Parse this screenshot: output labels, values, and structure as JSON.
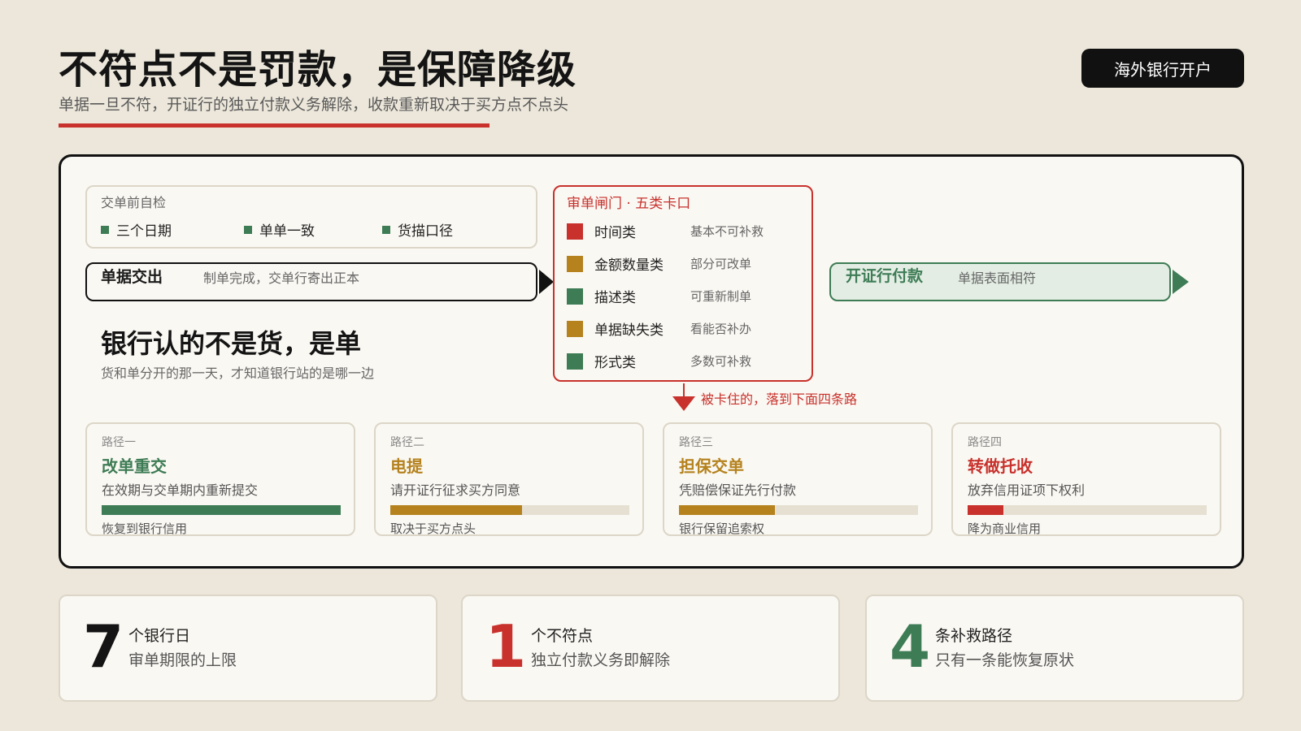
{
  "header": {
    "title": "不符点不是罚款，是保障降级",
    "subtitle": "单据一旦不符，开证行的独立付款义务解除，收款重新取决于买方点不点头",
    "tag": "海外银行开户"
  },
  "precheck": {
    "title": "交单前自检",
    "items": [
      "三个日期",
      "单单一致",
      "货描口径"
    ]
  },
  "submit": {
    "title": "单据交出",
    "desc": "制单完成，交单行寄出正本"
  },
  "headline": {
    "title": "银行认的不是货，是单",
    "sub": "货和单分开的那一天，才知道银行站的是哪一边"
  },
  "gate": {
    "title": "审单闸门 · 五类卡口",
    "rows": [
      {
        "label": "时间类",
        "note": "基本不可补救",
        "color": "#c8312c"
      },
      {
        "label": "金额数量类",
        "note": "部分可改单",
        "color": "#b5821e"
      },
      {
        "label": "描述类",
        "note": "可重新制单",
        "color": "#3e7c55"
      },
      {
        "label": "单据缺失类",
        "note": "看能否补办",
        "color": "#b5821e"
      },
      {
        "label": "形式类",
        "note": "多数可补救",
        "color": "#3e7c55"
      }
    ],
    "down_text": "被卡住的，落到下面四条路"
  },
  "payment": {
    "title": "开证行付款",
    "desc": "单据表面相符"
  },
  "paths": [
    {
      "num": "路径一",
      "name": "改单重交",
      "desc": "在效期与交单期内重新提交",
      "outcome": "恢复到银行信用",
      "level": 1.0,
      "color": "#3e7c55"
    },
    {
      "num": "路径二",
      "name": "电提",
      "desc": "请开证行征求买方同意",
      "outcome": "取决于买方点头",
      "level": 0.55,
      "color": "#b5821e"
    },
    {
      "num": "路径三",
      "name": "担保交单",
      "desc": "凭赔偿保证先行付款",
      "outcome": "银行保留追索权",
      "level": 0.4,
      "color": "#b5821e"
    },
    {
      "num": "路径四",
      "name": "转做托收",
      "desc": "放弃信用证项下权利",
      "outcome": "降为商业信用",
      "level": 0.15,
      "color": "#c8312c"
    }
  ],
  "stats": [
    {
      "num": "7",
      "label": "个银行日",
      "desc": "审单期限的上限",
      "color": "#141414"
    },
    {
      "num": "1",
      "label": "个不符点",
      "desc": "独立付款义务即解除",
      "color": "#c8312c"
    },
    {
      "num": "4",
      "label": "条补救路径",
      "desc": "只有一条能恢复原状",
      "color": "#3e7c55"
    }
  ]
}
